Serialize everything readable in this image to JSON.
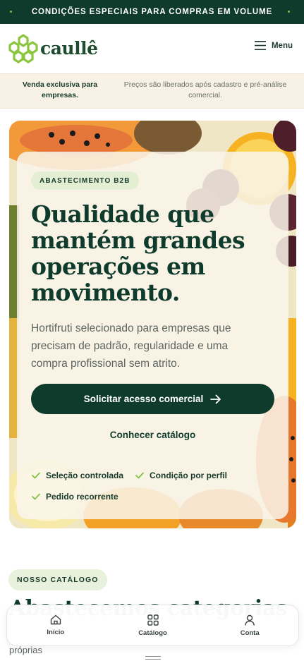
{
  "topbar": {
    "text": "CONDIÇÕES ESPECIAIS PARA COMPRAS EM VOLUME"
  },
  "header": {
    "brand": "caullê",
    "menu_label": "Menu"
  },
  "info": {
    "left": "Venda exclusiva para empresas.",
    "right": "Preços são liberados após cadastro e pré-análise comercial."
  },
  "hero": {
    "badge": "ABASTECIMENTO B2B",
    "title": "Qualidade que mantém grandes operações em movimento.",
    "description": "Hortifruti selecionado para empresas que precisam de padrão, regularidade e uma compra profissional sem atrito.",
    "cta_label": "Solicitar acesso comercial",
    "secondary_label": "Conhecer catálogo",
    "checks": [
      "Seleção controlada",
      "Condição por perfil",
      "Pedido recorrente"
    ]
  },
  "catalog_section": {
    "badge": "NOSSO CATÁLOGO",
    "title": "Abastecemos categorias",
    "subtitle": "próprias"
  },
  "bottom_nav": [
    {
      "label": "Início",
      "icon": "home-icon"
    },
    {
      "label": "Catálogo",
      "icon": "grid-icon"
    },
    {
      "label": "Conta",
      "icon": "user-icon"
    }
  ],
  "colors": {
    "brand_dark": "#0f3b2c",
    "brand_green": "#7fc241",
    "badge_bg": "#e3eed2",
    "cream": "#f7f2e5"
  }
}
